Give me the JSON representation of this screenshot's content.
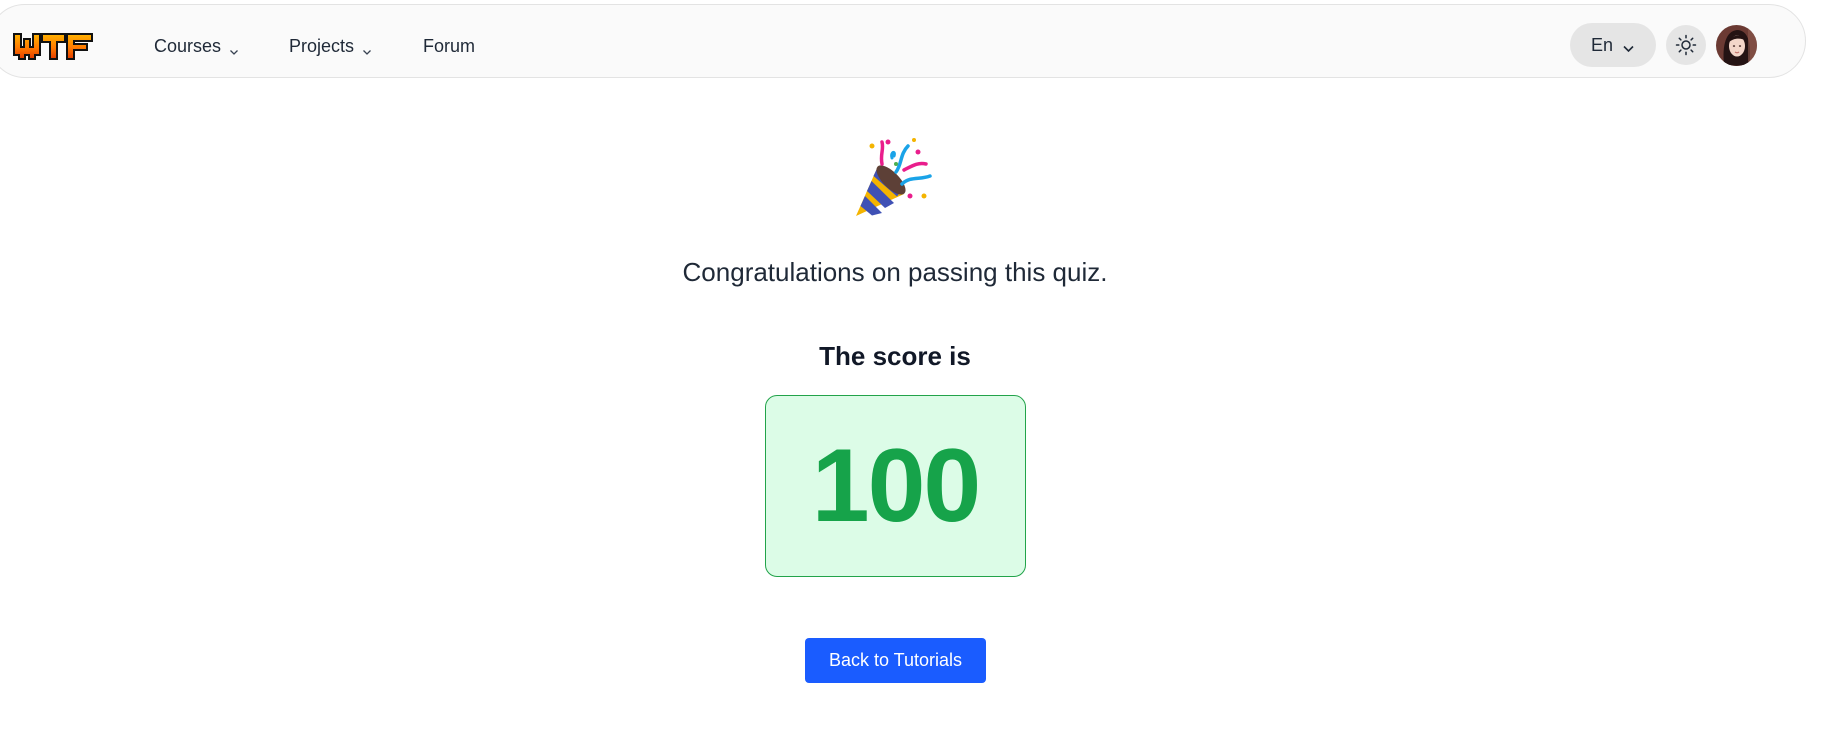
{
  "header": {
    "logo_text": "WTF",
    "nav": {
      "courses_label": "Courses",
      "projects_label": "Projects",
      "forum_label": "Forum"
    },
    "language_label": "En",
    "theme_icon": "sun-icon",
    "avatar_icon": "user-avatar"
  },
  "main": {
    "celebration_icon": "party-popper-icon",
    "congrats_text": "Congratulations on passing this quiz.",
    "score_label": "The score is",
    "score_value": "100",
    "back_button_label": "Back to Tutorials"
  },
  "colors": {
    "score_green": "#16a34a",
    "score_bg": "#dcfce7",
    "button_blue": "#1a5cff"
  }
}
